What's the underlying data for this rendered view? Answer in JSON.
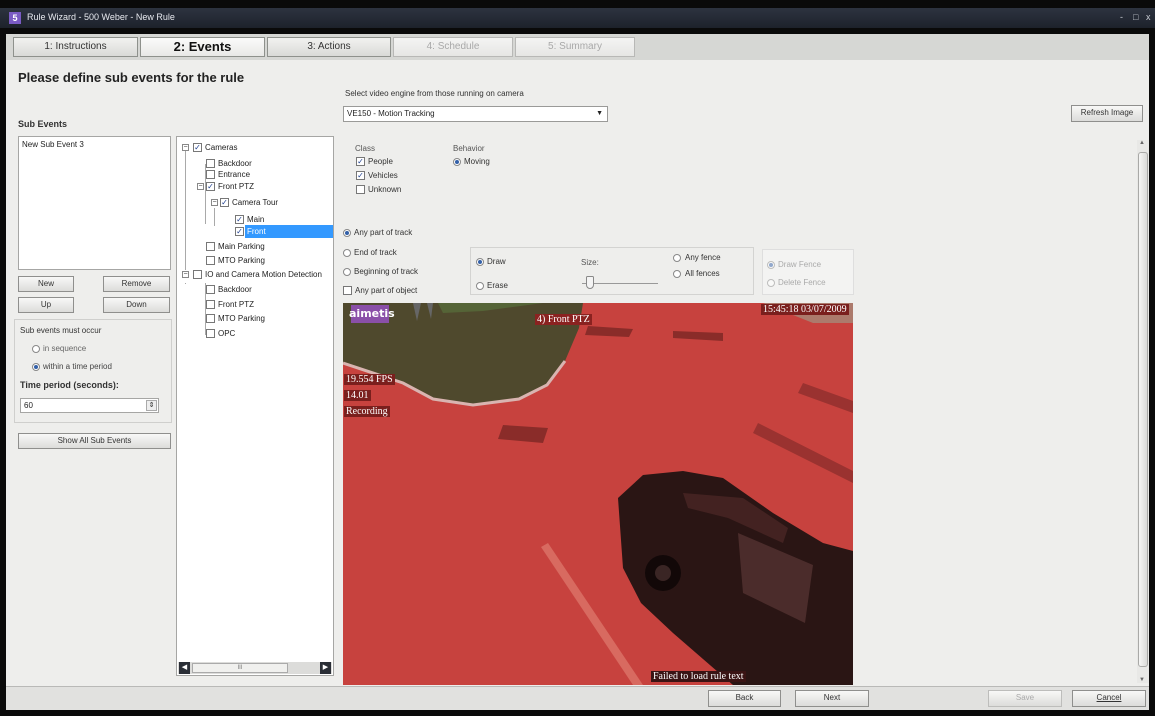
{
  "window": {
    "title": "Rule Wizard - 500 Weber - New Rule",
    "logo_letter": "5",
    "controls": [
      "-",
      "□",
      "x"
    ]
  },
  "tabs": [
    {
      "label": "1: Instructions",
      "state": "normal"
    },
    {
      "label": "2: Events",
      "state": "active"
    },
    {
      "label": "3: Actions",
      "state": "normal"
    },
    {
      "label": "4: Schedule",
      "state": "disabled"
    },
    {
      "label": "5: Summary",
      "state": "disabled"
    }
  ],
  "heading": "Please define sub events for the rule",
  "engine": {
    "label": "Select video engine from those running on camera",
    "value": "VE150 - Motion Tracking"
  },
  "refresh_label": "Refresh Image",
  "sub_events": {
    "title": "Sub Events",
    "items": [
      "New Sub Event 3"
    ],
    "new_label": "New",
    "remove_label": "Remove",
    "up_label": "Up",
    "down_label": "Down",
    "order_label": "Sub events must occur",
    "opt_sequence": "in sequence",
    "opt_period": "within a time period",
    "period_label": "Time period (seconds):",
    "period_value": "60",
    "show_all_label": "Show All Sub Events"
  },
  "tree": {
    "cameras": "Cameras",
    "backdoor": "Backdoor",
    "entrance": "Entrance",
    "front_ptz": "Front PTZ",
    "camera_tour": "Camera Tour",
    "main": "Main",
    "front": "Front",
    "main_parking": "Main Parking",
    "mto_parking": "MTO Parking",
    "io_motion": "IO and Camera Motion Detection",
    "io_backdoor": "Backdoor",
    "io_front_ptz": "Front PTZ",
    "io_mto_parking": "MTO Parking",
    "io_opc": "OPC",
    "scroll_thumb": "III"
  },
  "class_group": {
    "label": "Class",
    "people": "People",
    "vehicles": "Vehicles",
    "unknown": "Unknown"
  },
  "behavior_group": {
    "label": "Behavior",
    "moving": "Moving"
  },
  "track": {
    "any_part": "Any part of track",
    "end": "End of track",
    "beginning": "Beginning of track",
    "any_object": "Any part of object"
  },
  "draw": {
    "draw": "Draw",
    "erase": "Erase",
    "size": "Size:",
    "any_fence": "Any fence",
    "all_fences": "All fences",
    "draw_fence": "Draw Fence",
    "delete_fence": "Delete Fence"
  },
  "video": {
    "logo": "aimetis",
    "camera_label": "4) Front PTZ",
    "timestamp": "15:45:18 03/07/2009",
    "fps": "19.554 FPS",
    "time_small": "14.01",
    "recording": "Recording",
    "footer": "Failed to load rule text"
  },
  "footer": {
    "back": "Back",
    "next": "Next",
    "save": "Save",
    "cancel": "Cancel"
  },
  "colors": {
    "overlay": "#c23a36",
    "titlebar": "#2a2f3a",
    "selection": "#3399ff"
  }
}
